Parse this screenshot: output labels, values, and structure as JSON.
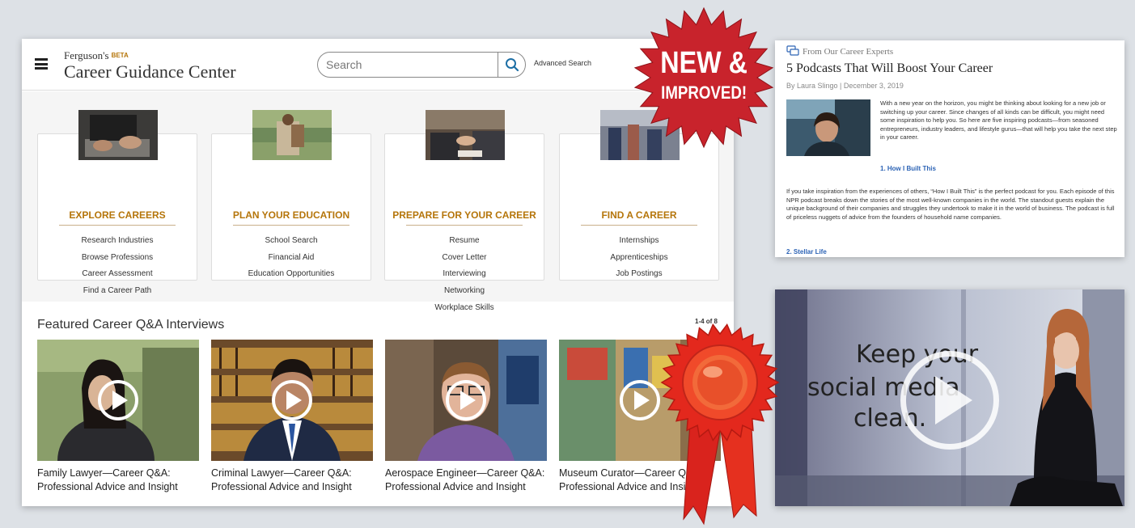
{
  "header": {
    "brand_name": "Ferguson's",
    "brand_badge": "BETA",
    "site_title": "Career Guidance Center",
    "search_placeholder": "Search",
    "advanced_search": "Advanced Search"
  },
  "categories": [
    {
      "title": "EXPLORE CAREERS",
      "links": [
        "Research Industries",
        "Browse Professions",
        "Career Assessment",
        "Find a Career Path"
      ]
    },
    {
      "title": "PLAN YOUR EDUCATION",
      "links": [
        "School Search",
        "Financial Aid",
        "Education Opportunities"
      ]
    },
    {
      "title": "PREPARE FOR YOUR CAREER",
      "links": [
        "Resume",
        "Cover Letter",
        "Interviewing",
        "Networking",
        "Workplace Skills"
      ]
    },
    {
      "title": "FIND A CAREER",
      "links": [
        "Internships",
        "Apprenticeships",
        "Job Postings"
      ]
    }
  ],
  "featured": {
    "title": "Featured Career Q&A Interviews",
    "count": "1-4 of 8",
    "videos": [
      {
        "caption": "Family Lawyer—Career Q&A: Professional Advice and Insight"
      },
      {
        "caption": "Criminal Lawyer—Career Q&A: Professional Advice and Insight"
      },
      {
        "caption": "Aerospace Engineer—Career Q&A: Professional Advice and Insight"
      },
      {
        "caption": "Museum Curator—Career Q&A: Professional Advice and Insight"
      }
    ]
  },
  "article": {
    "kicker": "From Our Career Experts",
    "title": "5 Podcasts That Will Boost Your Career",
    "byline": "By Laura Slingo | December 3, 2019",
    "para1": "With a new year on the horizon, you might be thinking about looking for a new job or switching up your career. Since changes of all kinds can be difficult, you might need some inspiration to help you. So here are five inspiring podcasts—from seasoned entrepreneurs, industry leaders, and lifestyle gurus—that will help you take the next step in your career.",
    "heading1": "1. How I Built This",
    "para2": "If you take inspiration from the experiences of others, “How I Built This” is the perfect podcast for you. Each episode of this NPR podcast breaks down the stories of the most well-known companies in the world. The standout guests explain the unique background of their companies and struggles they undertook to make it in the world of business. The podcast is full of priceless nuggets of advice from the founders of household name companies.",
    "heading2": "2. Stellar Life"
  },
  "big_video": {
    "line1": "Keep your",
    "line2": "social media",
    "line3": "clean."
  },
  "badge": {
    "line1": "NEW &",
    "line2": "IMPROVED!"
  },
  "colors": {
    "accent_gold": "#b5750a",
    "link_blue": "#2c63b5",
    "badge_red": "#c8232c",
    "search_teal": "#1d6fa5"
  }
}
